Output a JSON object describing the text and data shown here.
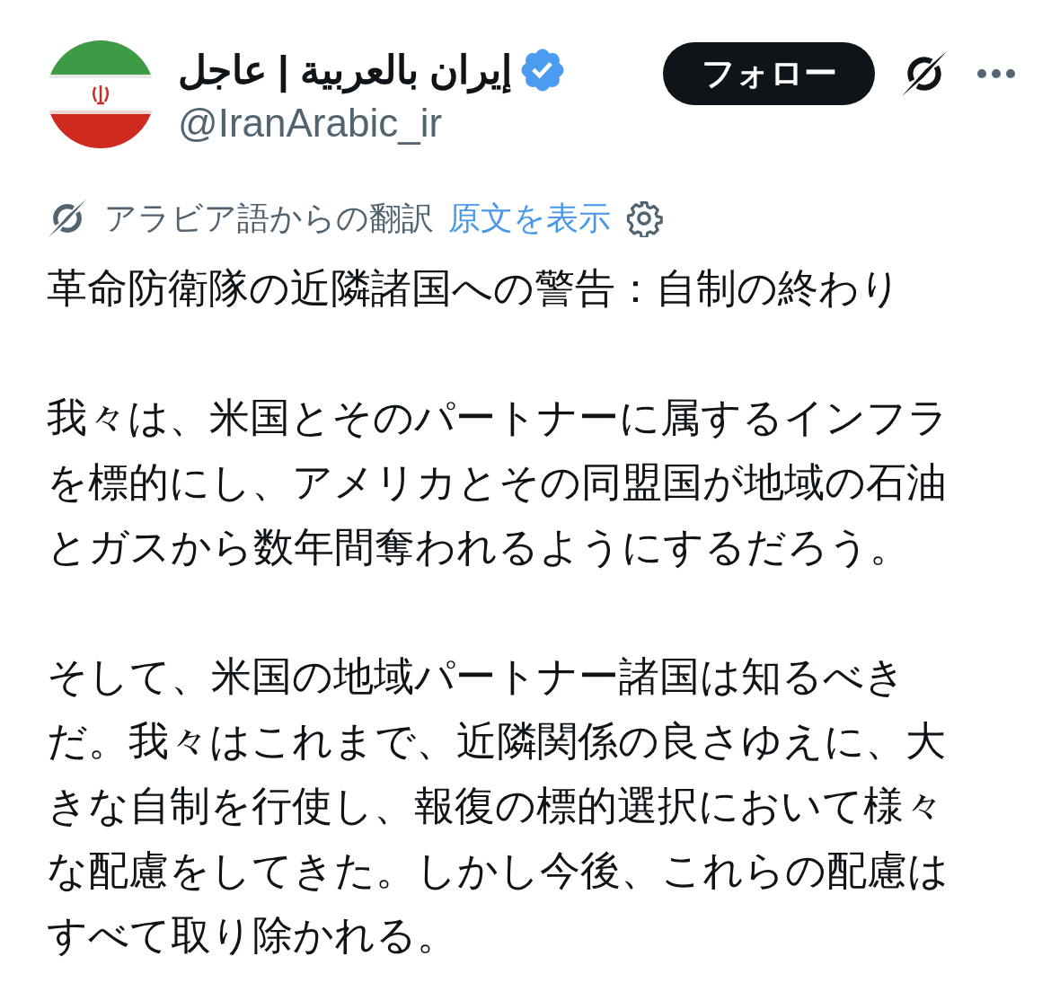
{
  "author": {
    "name": "إيران بالعربية | عاجل",
    "verified": true,
    "handle": "@IranArabic_ir"
  },
  "follow_button": {
    "label": "フォロー"
  },
  "translation": {
    "label": "アラビア語からの翻訳",
    "link": "原文を表示"
  },
  "paragraphs": [
    {
      "lines": [
        "革命防衛隊の近隣諸国への警告：自制の終わり"
      ]
    },
    {
      "lines": [
        "我々は、米国とそのパートナーに属するインフラ",
        "を標的にし、アメリカとその同盟国が地域の石油",
        "とガスから数年間奪われるようにするだろう。"
      ]
    },
    {
      "lines": [
        "そして、米国の地域パートナー諸国は知るべき",
        "だ。我々はこれまで、近隣関係の良さゆえに、大",
        "きな自制を行使し、報復の標的選択において様々",
        "な配慮をしてきた。しかし今後、これらの配慮は",
        "すべて取り除かれる。"
      ]
    }
  ]
}
